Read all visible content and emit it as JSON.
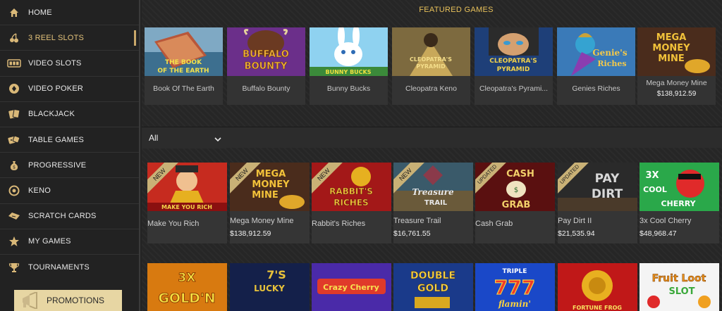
{
  "sidebar": {
    "items": [
      {
        "label": "HOME",
        "icon": "home-icon"
      },
      {
        "label": "3 REEL SLOTS",
        "icon": "cherries-icon"
      },
      {
        "label": "VIDEO SLOTS",
        "icon": "slot-reels-icon"
      },
      {
        "label": "VIDEO POKER",
        "icon": "poker-chip-icon"
      },
      {
        "label": "BLACKJACK",
        "icon": "cards-icon"
      },
      {
        "label": "TABLE GAMES",
        "icon": "dice-icon"
      },
      {
        "label": "PROGRESSIVE",
        "icon": "money-bag-icon"
      },
      {
        "label": "KENO",
        "icon": "keno-ball-icon"
      },
      {
        "label": "SCRATCH CARDS",
        "icon": "scratch-card-icon"
      },
      {
        "label": "MY GAMES",
        "icon": "star-icon"
      },
      {
        "label": "TOURNAMENTS",
        "icon": "trophy-icon"
      }
    ],
    "active_index": 1,
    "promotions_label": "PROMOTIONS"
  },
  "featured": {
    "title": "FEATURED GAMES",
    "games": [
      {
        "name": "Book Of The Earth",
        "jackpot": ""
      },
      {
        "name": "Buffalo Bounty",
        "jackpot": ""
      },
      {
        "name": "Bunny Bucks",
        "jackpot": ""
      },
      {
        "name": "Cleopatra Keno",
        "jackpot": ""
      },
      {
        "name": "Cleopatra's Pyrami...",
        "jackpot": ""
      },
      {
        "name": "Genies Riches",
        "jackpot": ""
      },
      {
        "name": "Mega Money Mine",
        "jackpot": "$138,912.59"
      }
    ]
  },
  "filter": {
    "value": "All"
  },
  "grid": {
    "row1": [
      {
        "name": "Make You Rich",
        "jackpot": "",
        "badge": "NEW"
      },
      {
        "name": "Mega Money Mine",
        "jackpot": "$138,912.59",
        "badge": "NEW"
      },
      {
        "name": "Rabbit's Riches",
        "jackpot": "",
        "badge": "NEW"
      },
      {
        "name": "Treasure Trail",
        "jackpot": "$16,761.55",
        "badge": "NEW"
      },
      {
        "name": "Cash Grab",
        "jackpot": "",
        "badge": "UPDATED"
      },
      {
        "name": "Pay Dirt II",
        "jackpot": "$21,535.94",
        "badge": "UPDATED"
      },
      {
        "name": "3x Cool Cherry",
        "jackpot": "$48,968.47",
        "badge": ""
      }
    ]
  },
  "colors": {
    "accent": "#e8c15a",
    "ribbon": "#c9b176",
    "sidebar_bg": "#222222"
  },
  "art_text": {
    "book_of_the_earth": [
      "THE BOOK",
      "OF THE EARTH"
    ],
    "buffalo_bounty": [
      "BUFFALO",
      "BOUNTY"
    ],
    "bunny_bucks": "BUNNY BUCKS",
    "cleopatra_keno": [
      "CLEOPATRA'S",
      "PYRAMID"
    ],
    "cleopatra_pyramid": [
      "CLEOPATRA'S",
      "PYRAMID"
    ],
    "genies_riches": [
      "Genie's",
      "Riches"
    ],
    "mega_money_mine": [
      "MEGA",
      "MONEY",
      "MINE"
    ],
    "make_you_rich": "MAKE YOU RICH",
    "rabbits_riches": [
      "RABBIT'S",
      "RICHES"
    ],
    "treasure_trail": [
      "Treasure",
      "TRAIL"
    ],
    "cash_grab": [
      "CASH",
      "GRAB"
    ],
    "pay_dirt": [
      "PAY",
      "DIRT"
    ],
    "cool_cherry": [
      "3X",
      "COOL",
      "CHERRY"
    ],
    "gold_n": [
      "3X",
      "GOLD'N"
    ],
    "lucky_7s": [
      "LUCKY",
      "7'S"
    ],
    "crazy_cherry": "Crazy Cherry",
    "double_gold": [
      "DOUBLE",
      "GOLD"
    ],
    "triple_777": [
      "TRIPLE",
      "777",
      "flamin'"
    ],
    "fortune_frog": "FORTUNE FROG",
    "fruit_loot": [
      "Fruit Loot",
      "SLOT"
    ]
  }
}
